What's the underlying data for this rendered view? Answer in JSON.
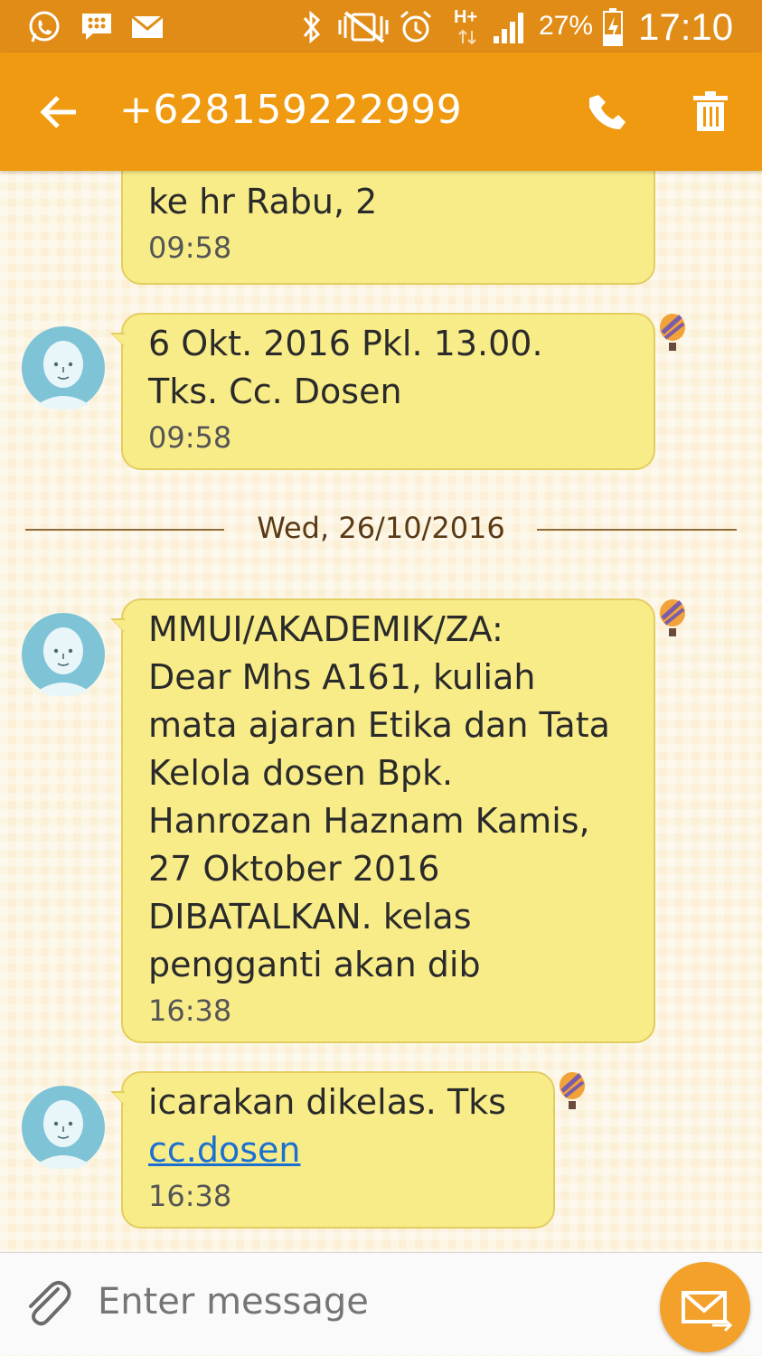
{
  "status_bar": {
    "battery": "27%",
    "time": "17:10",
    "network": "H+"
  },
  "header": {
    "title": "+628159222999"
  },
  "messages": [
    {
      "text": "ke hr Rabu, 2",
      "time": "09:58"
    },
    {
      "text": "6 Okt. 2016 Pkl. 13.00.\nTks. Cc. Dosen",
      "time": "09:58"
    },
    {
      "text": "MMUI/AKADEMIK/ZA:\nDear Mhs A161, kuliah\nmata ajaran Etika dan Tata\nKelola dosen Bpk.\nHanrozan Haznam Kamis,\n27 Oktober 2016\nDIBATALKAN. kelas\npengganti akan dib",
      "time": "16:38"
    },
    {
      "text": "icarakan dikelas. Tks",
      "link": "cc.dosen",
      "time": "16:38"
    }
  ],
  "date_separator": "Wed, 26/10/2016",
  "compose": {
    "placeholder": "Enter message"
  },
  "colors": {
    "status_bar": "#e08c17",
    "app_bar": "#f09a12",
    "bubble": "#f8ec89",
    "send_button": "#f3a12a"
  }
}
